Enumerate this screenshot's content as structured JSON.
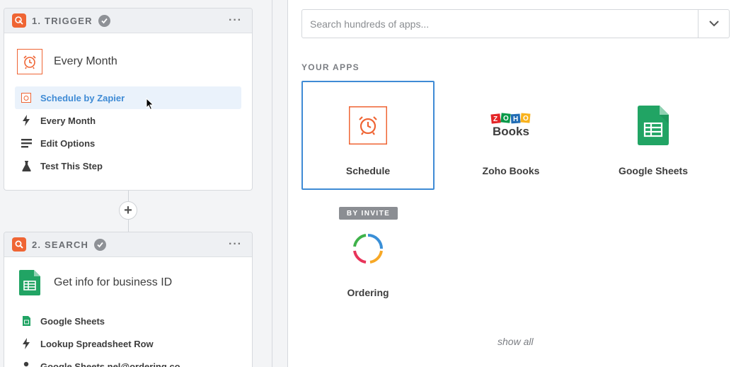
{
  "steps": [
    {
      "title": "1. TRIGGER",
      "heading": "Every Month",
      "items": [
        {
          "label": "Schedule by Zapier",
          "icon": "schedule-icon",
          "active": true
        },
        {
          "label": "Every Month",
          "icon": "bolt-icon"
        },
        {
          "label": "Edit Options",
          "icon": "lines-icon"
        },
        {
          "label": "Test This Step",
          "icon": "flask-icon"
        }
      ]
    },
    {
      "title": "2. SEARCH",
      "heading": "Get info for business ID",
      "items": [
        {
          "label": "Google Sheets",
          "icon": "sheets-icon"
        },
        {
          "label": "Lookup Spreadsheet Row",
          "icon": "bolt-icon"
        },
        {
          "label": "Google Sheets nel@ordering.co",
          "icon": "person-icon"
        }
      ]
    }
  ],
  "search": {
    "placeholder": "Search hundreds of apps..."
  },
  "apps_section": {
    "label": "YOUR APPS",
    "apps": [
      {
        "label": "Schedule",
        "icon": "schedule-icon",
        "selected": true
      },
      {
        "label": "Zoho Books",
        "icon": "zoho-books-logo",
        "logo_text": "Books"
      },
      {
        "label": "Google Sheets",
        "icon": "sheets-icon"
      },
      {
        "label": "Ordering",
        "icon": "ordering-icon",
        "badge": "BY INVITE"
      }
    ],
    "show_all": "show all"
  },
  "colors": {
    "accent": "#3f8bd5",
    "zapier_orange": "#ef6534",
    "sheets_green": "#21a464"
  }
}
